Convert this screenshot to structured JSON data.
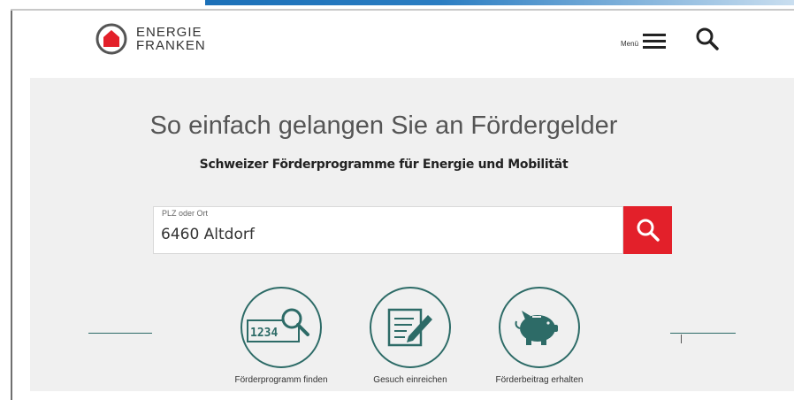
{
  "brand": {
    "line1": "ENERGIE",
    "line2": "FRANKEN"
  },
  "header": {
    "menu_label": "Menü"
  },
  "hero": {
    "headline": "So einfach gelangen Sie an Fördergelder",
    "subline": "Schweizer Förderprogramme für Energie und Mobilität"
  },
  "search": {
    "label": "PLZ oder Ort",
    "value": "6460 Altdorf"
  },
  "steps": [
    {
      "label": "Förderprogramm finden",
      "icon": "magnifier-number-icon",
      "icon_text": "1234"
    },
    {
      "label": "Gesuch einreichen",
      "icon": "document-pen-icon"
    },
    {
      "label": "Förderbeitrag erhalten",
      "icon": "piggy-bank-icon"
    }
  ],
  "colors": {
    "accent_red": "#e3202a",
    "teal": "#2d6b67",
    "hero_bg": "#f0f0f0"
  }
}
